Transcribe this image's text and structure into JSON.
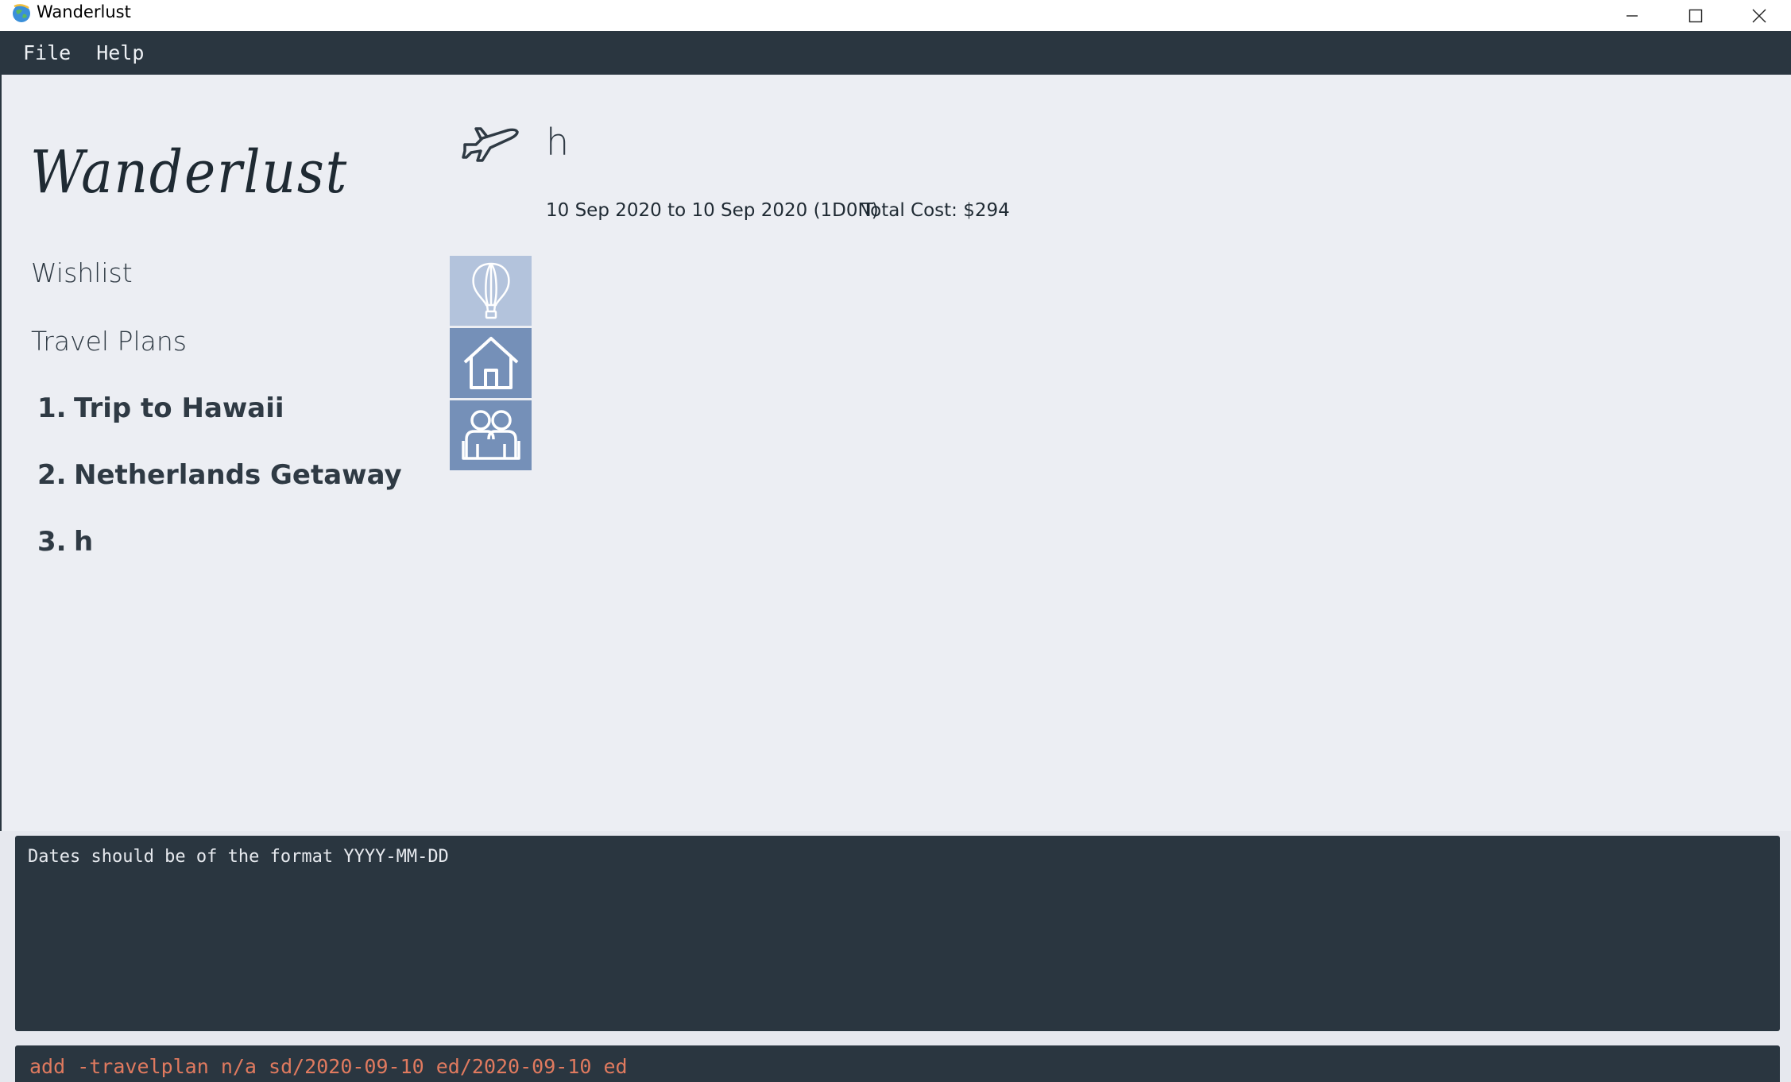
{
  "window": {
    "title": "Wanderlust"
  },
  "menu": {
    "file": "File",
    "help": "Help"
  },
  "sidebar": {
    "logo_text": "Wanderlust",
    "wishlist": "Wishlist",
    "travel_plans": "Travel Plans",
    "plans": [
      {
        "num": "1.",
        "name": "Trip to Hawaii"
      },
      {
        "num": "2.",
        "name": "Netherlands Getaway"
      },
      {
        "num": "3.",
        "name": "h"
      }
    ]
  },
  "detail": {
    "title": "h",
    "dates": "10 Sep 2020 to 10 Sep 2020 (1D0N)",
    "total_cost": "Total Cost: $294",
    "tabs": [
      {
        "icon": "hot-air-balloon-icon",
        "active": true
      },
      {
        "icon": "house-icon",
        "active": false
      },
      {
        "icon": "friends-icon",
        "active": false
      }
    ]
  },
  "result": {
    "message": "Dates should be of the format YYYY-MM-DD"
  },
  "command": {
    "value": "add -travelplan n/a sd/2020-09-10 ed/2020-09-10 ed"
  },
  "colors": {
    "menubar": "#2a3640",
    "background": "#eceef3",
    "tab_active": "#b3c3dc",
    "tab_inactive": "#7590b8",
    "command_text": "#e07a5f"
  }
}
